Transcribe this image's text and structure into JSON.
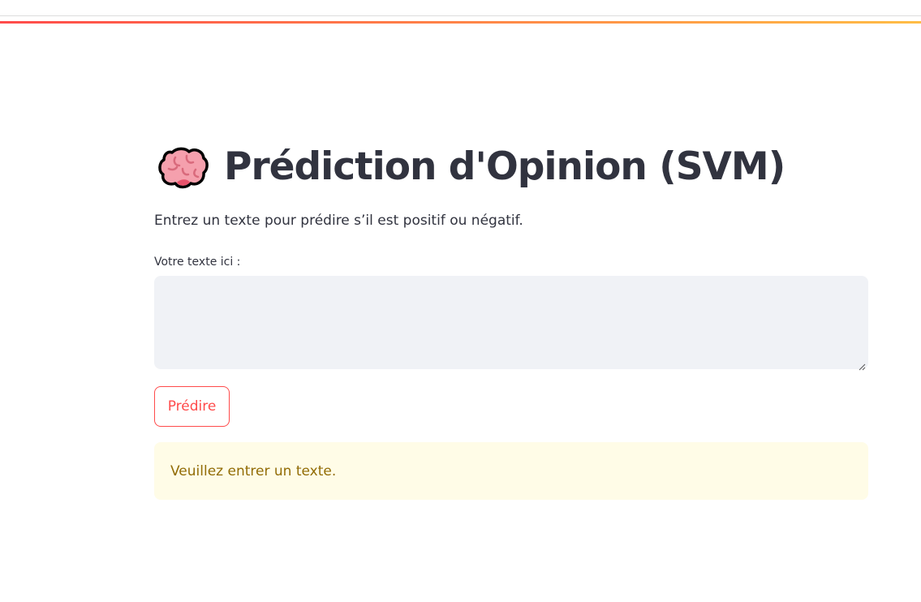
{
  "app": {
    "accent_color": "#ff4b4b",
    "gradient_end_color": "#ffbd45"
  },
  "header": {
    "icon": "brain-icon",
    "title": "Prédiction d'Opinion (SVM)"
  },
  "intro": {
    "text": "Entrez un texte pour prédire s’il est positif ou négatif."
  },
  "form": {
    "text_label": "Votre texte ici :",
    "text_value": "",
    "text_placeholder": "",
    "predict_label": "Prédire"
  },
  "alert": {
    "type": "warning",
    "message": "Veuillez entrer un texte."
  }
}
